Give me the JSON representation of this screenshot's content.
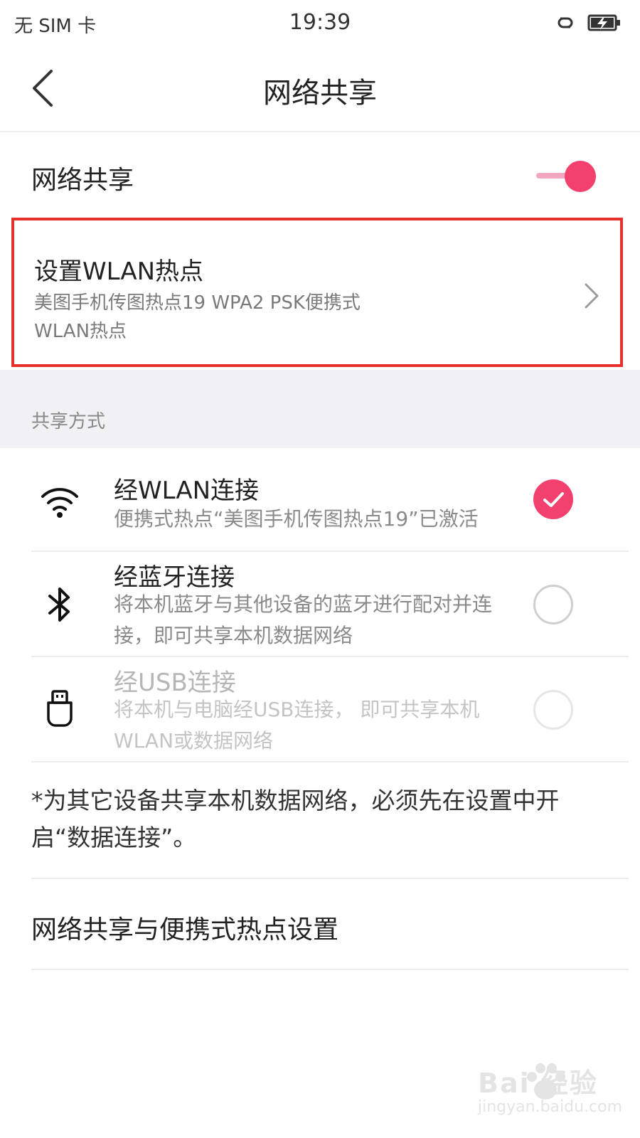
{
  "status_bar": {
    "sim_text": "无 SIM 卡",
    "time": "19:39"
  },
  "nav": {
    "title": "网络共享"
  },
  "tethering": {
    "label": "网络共享",
    "enabled": true
  },
  "hotspot": {
    "title": "设置WLAN热点",
    "subtitle_line1": "美图手机传图热点19 WPA2 PSK便携式",
    "subtitle_line2": "WLAN热点"
  },
  "section": {
    "label": "共享方式"
  },
  "options": [
    {
      "title": "经WLAN连接",
      "subtitle_line1": "便携式热点“美图手机传图热点19”已激活",
      "subtitle_line2": "",
      "icon": "wifi-icon",
      "checked": true,
      "enabled": true
    },
    {
      "title": "经蓝牙连接",
      "subtitle_line1": "将本机蓝牙与其他设备的蓝牙进行配对并连",
      "subtitle_line2": "接，即可共享本机数据网络",
      "icon": "bluetooth-icon",
      "checked": false,
      "enabled": true
    },
    {
      "title": "经USB连接",
      "subtitle_line1": "将本机与电脑经USB连接， 即可共享本机",
      "subtitle_line2": "WLAN或数据网络",
      "icon": "usb-icon",
      "checked": false,
      "enabled": false
    }
  ],
  "note": {
    "line1": "*为其它设备共享本机数据网络，必须先在设置中开",
    "line2": "启“数据连接”。"
  },
  "settings_link": {
    "label": "网络共享与便携式热点设置"
  },
  "watermark": {
    "brand": "Bai 经验",
    "url": "jingyan.baidu.com"
  },
  "colors": {
    "accent": "#f2406f",
    "highlight_box": "#e8302d",
    "section_bg": "#f1f0f5"
  }
}
